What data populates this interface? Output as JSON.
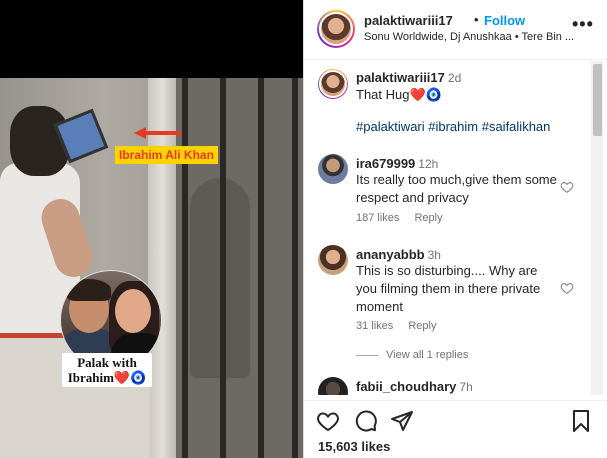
{
  "video_overlay": {
    "name_label": "Ibrahim Ali Khan",
    "inset_caption_line1": "Palak with",
    "inset_caption_line2": "Ibrahim❤️🧿"
  },
  "post": {
    "username": "palaktiwariii17",
    "separator": "•",
    "follow_label": "Follow",
    "audio": "Sonu Worldwide, Dj Anushkaa • Tere Bin ...",
    "more_icon": "more-horizontal-icon"
  },
  "caption": {
    "username": "palaktiwariii17",
    "time": "2d",
    "text": "That Hug❤️🧿",
    "hashtags": "#palaktiwari #ibrahim #saifalikhan"
  },
  "comments": [
    {
      "username": "ira679999",
      "time": "12h",
      "text": "Its really too much,give them some respect and privacy",
      "likes": "187 likes",
      "reply": "Reply"
    },
    {
      "username": "ananyabbb",
      "time": "3h",
      "text": "This is so disturbing.... Why are you filming them in there private moment",
      "likes": "31 likes",
      "reply": "Reply"
    },
    {
      "username": "fabii_choudhary",
      "time": "7h"
    }
  ],
  "view_replies": "View all 1 replies",
  "actions": {
    "icons": [
      "heart-icon",
      "comment-icon",
      "share-icon",
      "bookmark-icon"
    ],
    "likes_count": "15,603",
    "likes_label": "likes"
  },
  "colors": {
    "follow": "#0095f6",
    "hashtag": "#00376b",
    "muted": "#737373",
    "text": "#262626"
  }
}
